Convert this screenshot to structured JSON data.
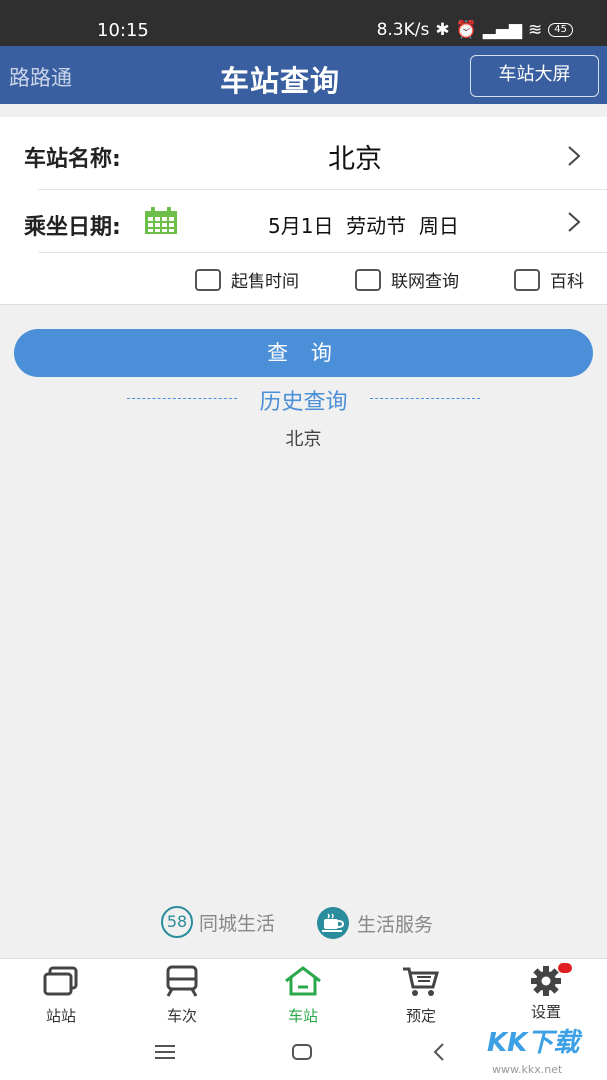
{
  "status": {
    "time": "10:15",
    "speed": "8.3K/s",
    "battery": "45"
  },
  "appbar": {
    "app_name": "路路通",
    "title": "车站查询",
    "screen_button": "车站大屏"
  },
  "form": {
    "station_label": "车站名称:",
    "station_value": "北京",
    "date_label": "乘坐日期:",
    "date_value": "5月1日  劳动节  周日",
    "options": [
      "起售时间",
      "联网查询",
      "百科"
    ]
  },
  "query_button": "查 询",
  "history": {
    "title": "历史查询",
    "items": [
      "北京"
    ]
  },
  "links": [
    "同城生活",
    "生活服务"
  ],
  "link_badge": "58",
  "tabs": [
    {
      "label": "站站",
      "icon": "stations-icon"
    },
    {
      "label": "车次",
      "icon": "train-icon"
    },
    {
      "label": "车站",
      "icon": "home-icon"
    },
    {
      "label": "预定",
      "icon": "cart-icon"
    },
    {
      "label": "设置",
      "icon": "gear-icon"
    }
  ],
  "active_tab": "车站",
  "watermark": {
    "text": "KK下载",
    "sub": "www.kkx.net"
  },
  "colors": {
    "appbar": "#3a5fa0",
    "accent": "#4a8fd8",
    "active_tab": "#2aa84a",
    "teal": "#2a8c9c"
  }
}
